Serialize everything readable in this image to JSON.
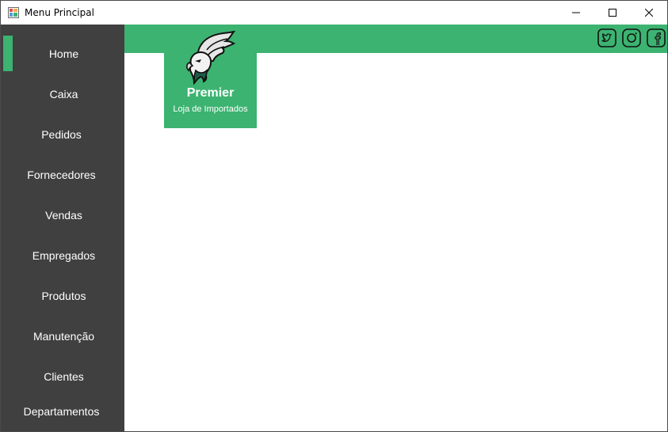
{
  "window": {
    "title": "Menu Principal"
  },
  "sidebar": {
    "items": [
      {
        "label": "Home",
        "active": true
      },
      {
        "label": "Caixa"
      },
      {
        "label": "Pedidos"
      },
      {
        "label": "Fornecedores"
      },
      {
        "label": "Vendas"
      },
      {
        "label": "Empregados"
      },
      {
        "label": "Produtos"
      },
      {
        "label": "Manutenção"
      },
      {
        "label": "Clientes"
      },
      {
        "label": "Departamentos"
      }
    ]
  },
  "brand": {
    "name": "Premier",
    "subtitle": "Loja de Importados"
  },
  "social": [
    "twitter-icon",
    "instagram-icon",
    "facebook-icon"
  ],
  "colors": {
    "accent": "#3cb371",
    "sidebar": "#404040",
    "text_on_dark": "#ffffff"
  }
}
